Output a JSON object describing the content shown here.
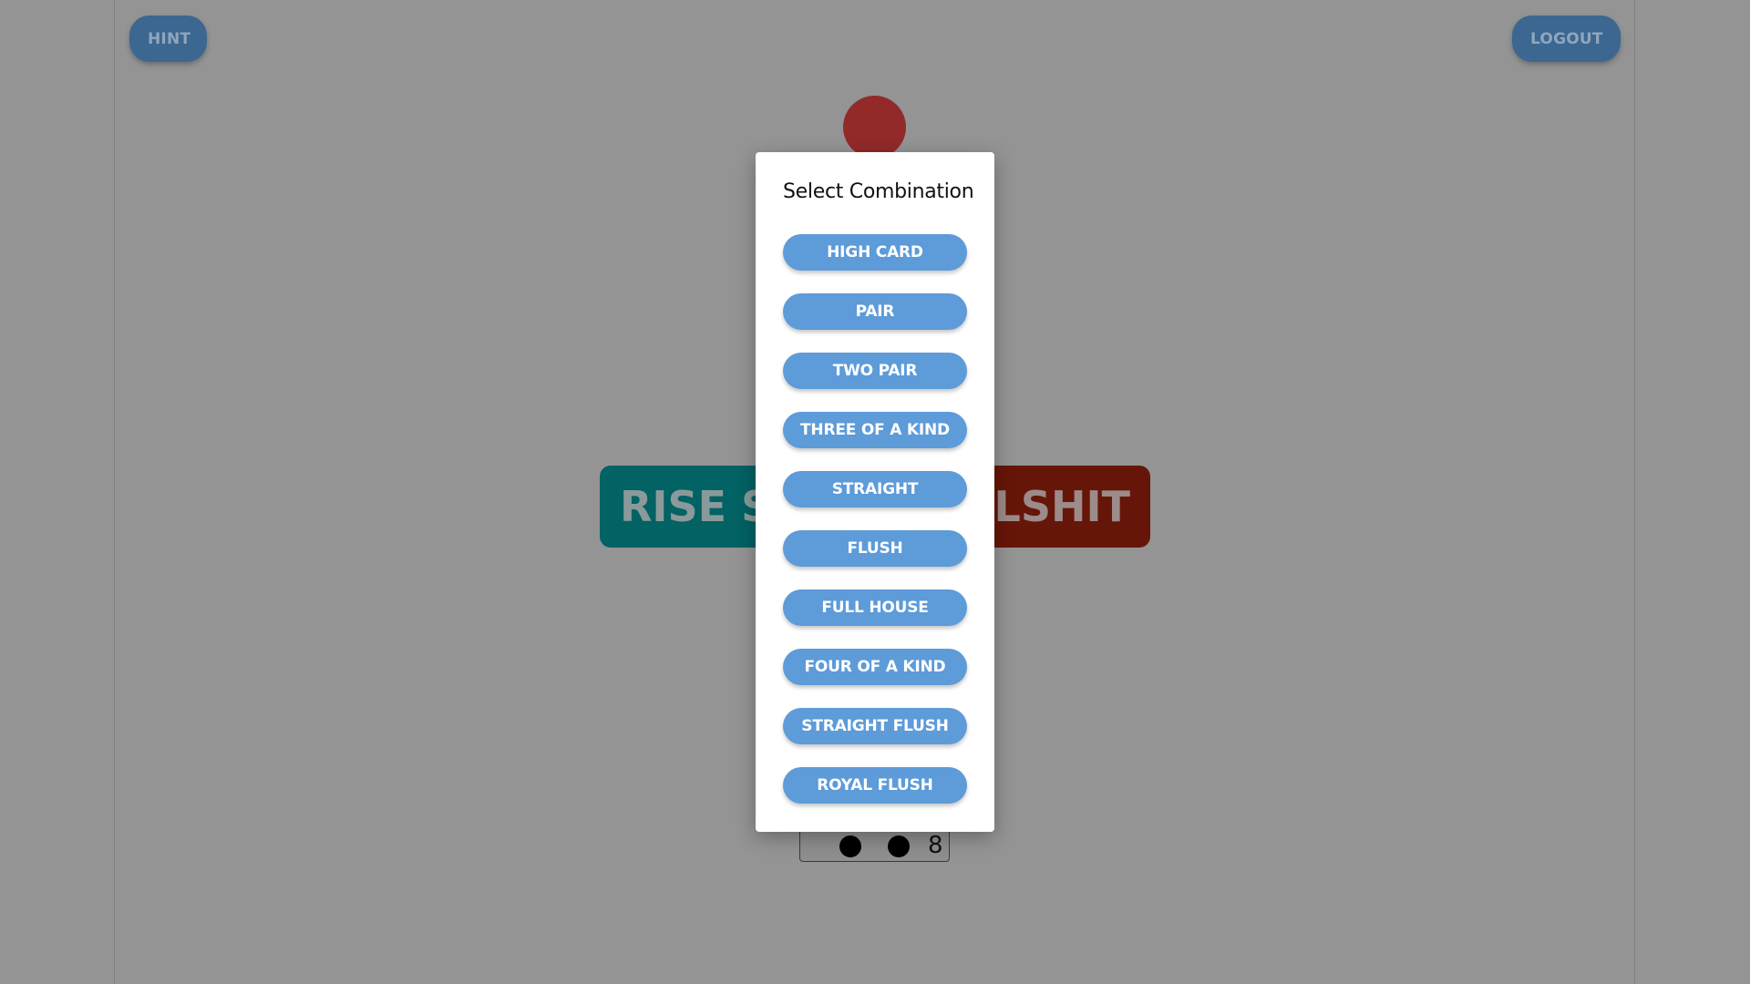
{
  "header": {
    "hint_label": "HINT",
    "logout_label": "LOGOUT"
  },
  "actions": {
    "rise_stakes_label": "RISE STAKES",
    "bullshit_label": "BULLSHIT"
  },
  "card": {
    "rank": "8"
  },
  "modal": {
    "title": "Select Combination",
    "combinations": [
      "HIGH CARD",
      "PAIR",
      "TWO PAIR",
      "THREE OF A KIND",
      "STRAIGHT",
      "FLUSH",
      "FULL HOUSE",
      "FOUR OF A KIND",
      "STRAIGHT FLUSH",
      "ROYAL FLUSH"
    ]
  },
  "colors": {
    "overlay_background": "#949495",
    "corner_button": "#3b6791",
    "rise_button": "#026264",
    "bullshit_button": "#661608",
    "player_dot": "#922a2a",
    "combination_button": "#5d9bd9",
    "modal_background": "#ffffff"
  }
}
